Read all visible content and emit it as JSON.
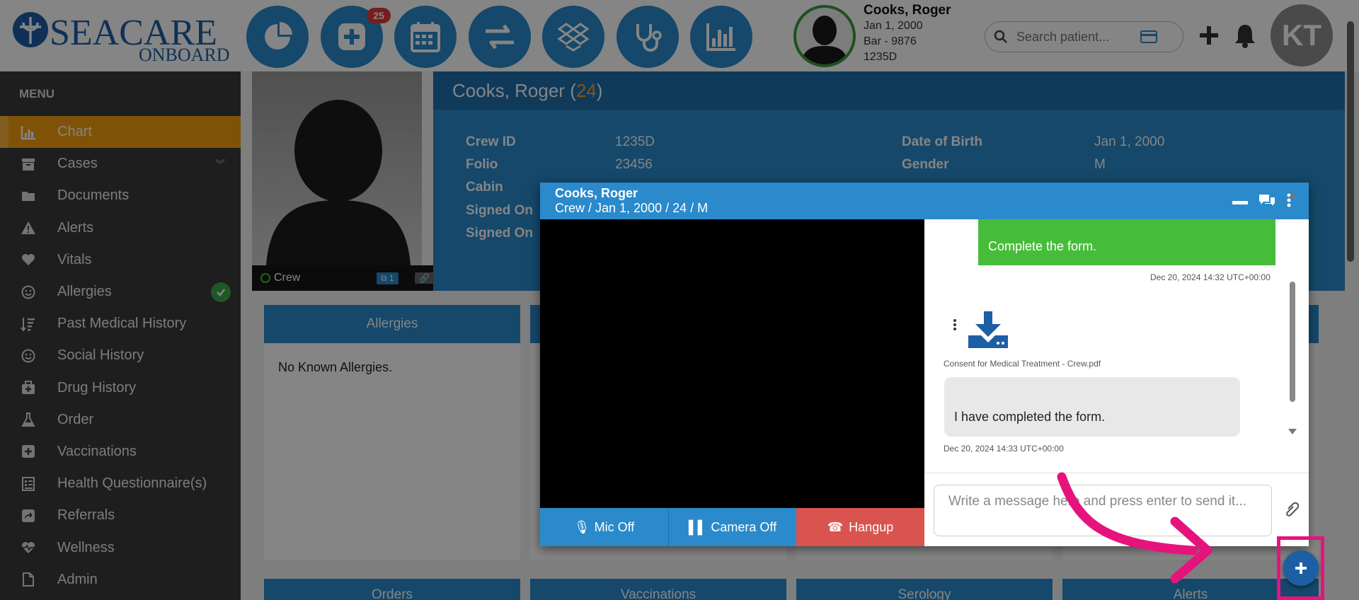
{
  "brand": {
    "logo_text_top": "SEACARE",
    "logo_text_bottom": "ONBOARD"
  },
  "nav": {
    "buttons": [
      "dashboard-icon",
      "add-case-icon",
      "calendar-icon",
      "transfer-icon",
      "dropbox-icon",
      "stethoscope-icon",
      "bar-chart-icon"
    ],
    "badge_count": "25"
  },
  "patient": {
    "name": "Cooks, Roger",
    "dob": "Jan 1, 2000",
    "vessel": "Bar - 9876",
    "crew_id": "1235D"
  },
  "search": {
    "placeholder": "Search patient..."
  },
  "user": {
    "initials": "KT"
  },
  "sidebar": {
    "title": "MENU",
    "items": [
      {
        "label": "Chart",
        "icon": "bar-chart-icon"
      },
      {
        "label": "Cases",
        "icon": "archive-icon"
      },
      {
        "label": "Documents",
        "icon": "folder-icon"
      },
      {
        "label": "Alerts",
        "icon": "warning-icon"
      },
      {
        "label": "Vitals",
        "icon": "heart-icon"
      },
      {
        "label": "Allergies",
        "icon": "smile-icon"
      },
      {
        "label": "Past Medical History",
        "icon": "sort-icon"
      },
      {
        "label": "Social History",
        "icon": "smile-icon"
      },
      {
        "label": "Drug History",
        "icon": "medkit-icon"
      },
      {
        "label": "Order",
        "icon": "flask-icon"
      },
      {
        "label": "Vaccinations",
        "icon": "plus-square-icon"
      },
      {
        "label": "Health Questionnaire(s)",
        "icon": "form-icon"
      },
      {
        "label": "Referrals",
        "icon": "share-icon"
      },
      {
        "label": "Wellness",
        "icon": "heartbeat-icon"
      },
      {
        "label": "Admin",
        "icon": "file-icon"
      }
    ]
  },
  "header": {
    "name": "Cooks, Roger",
    "age": "24",
    "fields": {
      "crew_id_label": "Crew ID",
      "crew_id": "1235D",
      "folio_label": "Folio",
      "folio": "23456",
      "cabin_label": "Cabin",
      "signed_on_label_1": "Signed On",
      "signed_on_label_2": "Signed On",
      "dob_label": "Date of Birth",
      "dob": "Jan 1, 2000",
      "gender_label": "Gender",
      "gender": "M"
    }
  },
  "photo_footer": {
    "status": "Crew",
    "count": "1"
  },
  "cards": {
    "allergies_title": "Allergies",
    "allergies_text": "No Known Allergies.",
    "orders": "Orders",
    "vaccinations": "Vaccinations",
    "serology": "Serology",
    "alerts": "Alerts"
  },
  "videocall": {
    "name": "Cooks, Roger",
    "subtitle": "Crew / Jan 1, 2000 / 24 / M",
    "mic_label": "Mic Off",
    "camera_label": "Camera Off",
    "hangup_label": "Hangup",
    "messages": {
      "outgoing_text": "Complete the form.",
      "outgoing_ts": "Dec 20, 2024 14:32 UTC+00:00",
      "file_name": "Consent for Medical Treatment - Crew.pdf",
      "incoming_text": "I have completed the form.",
      "incoming_ts": "Dec 20, 2024 14:33 UTC+00:00"
    },
    "input_placeholder": "Write a message here and press enter to send it..."
  },
  "colors": {
    "primary": "#2a8acb",
    "active_menu": "#f59d0e",
    "hangup": "#d9534f",
    "success": "#3aa94a",
    "highlight": "#e6137d",
    "badge": "#e23b3b"
  }
}
